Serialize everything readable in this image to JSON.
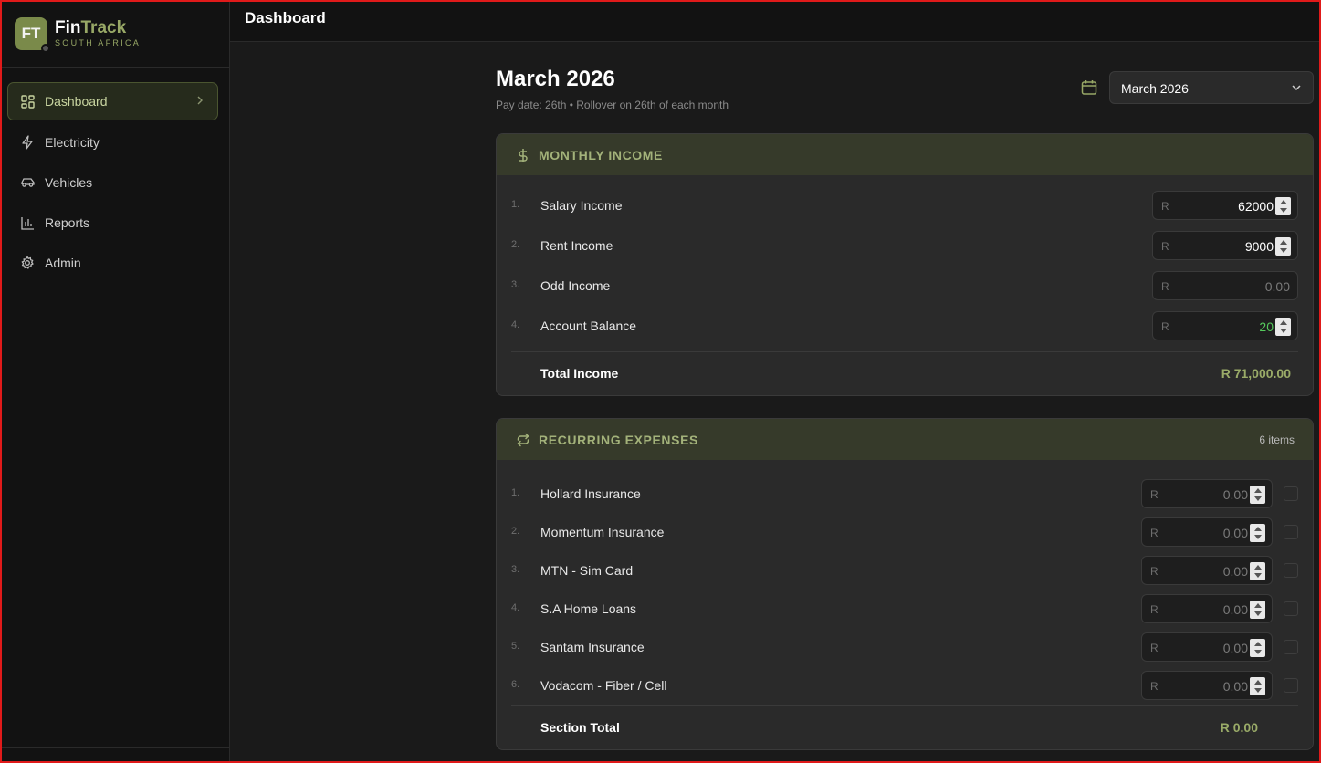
{
  "brand": {
    "logo_initials": "FT",
    "name_part1": "Fin",
    "name_part2": "Track",
    "subtitle": "SOUTH AFRICA"
  },
  "sidebar": {
    "items": [
      {
        "label": "Dashboard",
        "icon": "dashboard-grid-icon",
        "active": true
      },
      {
        "label": "Electricity",
        "icon": "lightning-icon"
      },
      {
        "label": "Vehicles",
        "icon": "car-icon"
      },
      {
        "label": "Reports",
        "icon": "bar-chart-icon"
      },
      {
        "label": "Admin",
        "icon": "gear-icon"
      }
    ]
  },
  "header": {
    "title": "Dashboard"
  },
  "page": {
    "title": "March 2026",
    "subtitle": "Pay date: 26th • Rollover on 26th of each month",
    "month_select": "March 2026"
  },
  "income": {
    "title": "MONTHLY INCOME",
    "currency": "R",
    "rows": [
      {
        "num": "1.",
        "label": "Salary Income",
        "value": "62000"
      },
      {
        "num": "2.",
        "label": "Rent Income",
        "value": "9000"
      },
      {
        "num": "3.",
        "label": "Odd Income",
        "value": "0.00"
      },
      {
        "num": "4.",
        "label": "Account Balance",
        "value": "20"
      }
    ],
    "total_label": "Total Income",
    "total_value": "R 71,000.00"
  },
  "expenses": {
    "title": "RECURRING EXPENSES",
    "count": "6 items",
    "currency": "R",
    "rows": [
      {
        "num": "1.",
        "label": "Hollard Insurance",
        "value": "0.00"
      },
      {
        "num": "2.",
        "label": "Momentum Insurance",
        "value": "0.00"
      },
      {
        "num": "3.",
        "label": "MTN - Sim Card",
        "value": "0.00"
      },
      {
        "num": "4.",
        "label": "S.A Home Loans",
        "value": "0.00"
      },
      {
        "num": "5.",
        "label": "Santam Insurance",
        "value": "0.00"
      },
      {
        "num": "6.",
        "label": "Vodacom - Fiber / Cell",
        "value": "0.00"
      }
    ],
    "total_label": "Section Total",
    "total_value": "R 0.00"
  },
  "colors": {
    "accent": "#98a866",
    "positive": "#55c95c",
    "frame": "#e01a1a"
  }
}
